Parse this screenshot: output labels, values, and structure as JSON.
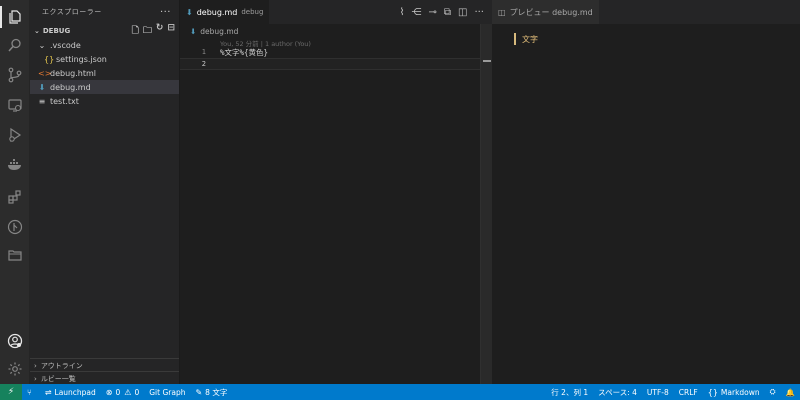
{
  "activity_bar": {
    "icons": [
      "explorer-icon",
      "search-icon",
      "source-control-icon",
      "remote-explorer-icon",
      "run-debug-icon",
      "docker-icon",
      "extensions-icon",
      "git-graph-icon",
      "folder-icon"
    ],
    "bottom_icons": [
      "account-icon",
      "settings-gear-icon"
    ]
  },
  "sidebar": {
    "title": "エクスプローラー",
    "more": "···",
    "section": "DEBUG",
    "tree": [
      {
        "label": ".vscode",
        "icon": "⌄",
        "icon_color": "#cccccc",
        "indent": 1
      },
      {
        "label": "settings.json",
        "icon": "{}",
        "icon_color": "#e8c94f",
        "indent": 2
      },
      {
        "label": "debug.html",
        "icon": "<>",
        "icon_color": "#e37933",
        "indent": 1
      },
      {
        "label": "debug.md",
        "icon": "⬇",
        "icon_color": "#519aba",
        "indent": 1
      },
      {
        "label": "test.txt",
        "icon": "≡",
        "icon_color": "#cccccc",
        "indent": 1
      }
    ],
    "outline": "アウトライン",
    "ruby_list": "ルビー一覧"
  },
  "editor": {
    "tab_label": "debug.md",
    "tab_sublabel": "debug",
    "breadcrumb": "debug.md",
    "blame": "You, 52 分前 | 1 author (You)",
    "lines": [
      {
        "num": "1",
        "text": "%文字%{黄色}"
      },
      {
        "num": "2",
        "text": ""
      }
    ]
  },
  "preview": {
    "tab_label": "プレビュー debug.md",
    "content": "文字",
    "accent": "#e5c07b"
  },
  "statusbar": {
    "launchpad": "Launchpad",
    "errors": "0",
    "warnings": "0",
    "git_graph": "Git Graph",
    "char_count": "8 文字",
    "cursor": "行 2、列 1",
    "spaces": "スペース: 4",
    "encoding": "UTF-8",
    "eol": "CRLF",
    "language": "Markdown"
  },
  "colors": {
    "statusbar": "#007acc",
    "remote": "#16825d",
    "sidebar": "#252526",
    "editor": "#1e1e1e"
  }
}
